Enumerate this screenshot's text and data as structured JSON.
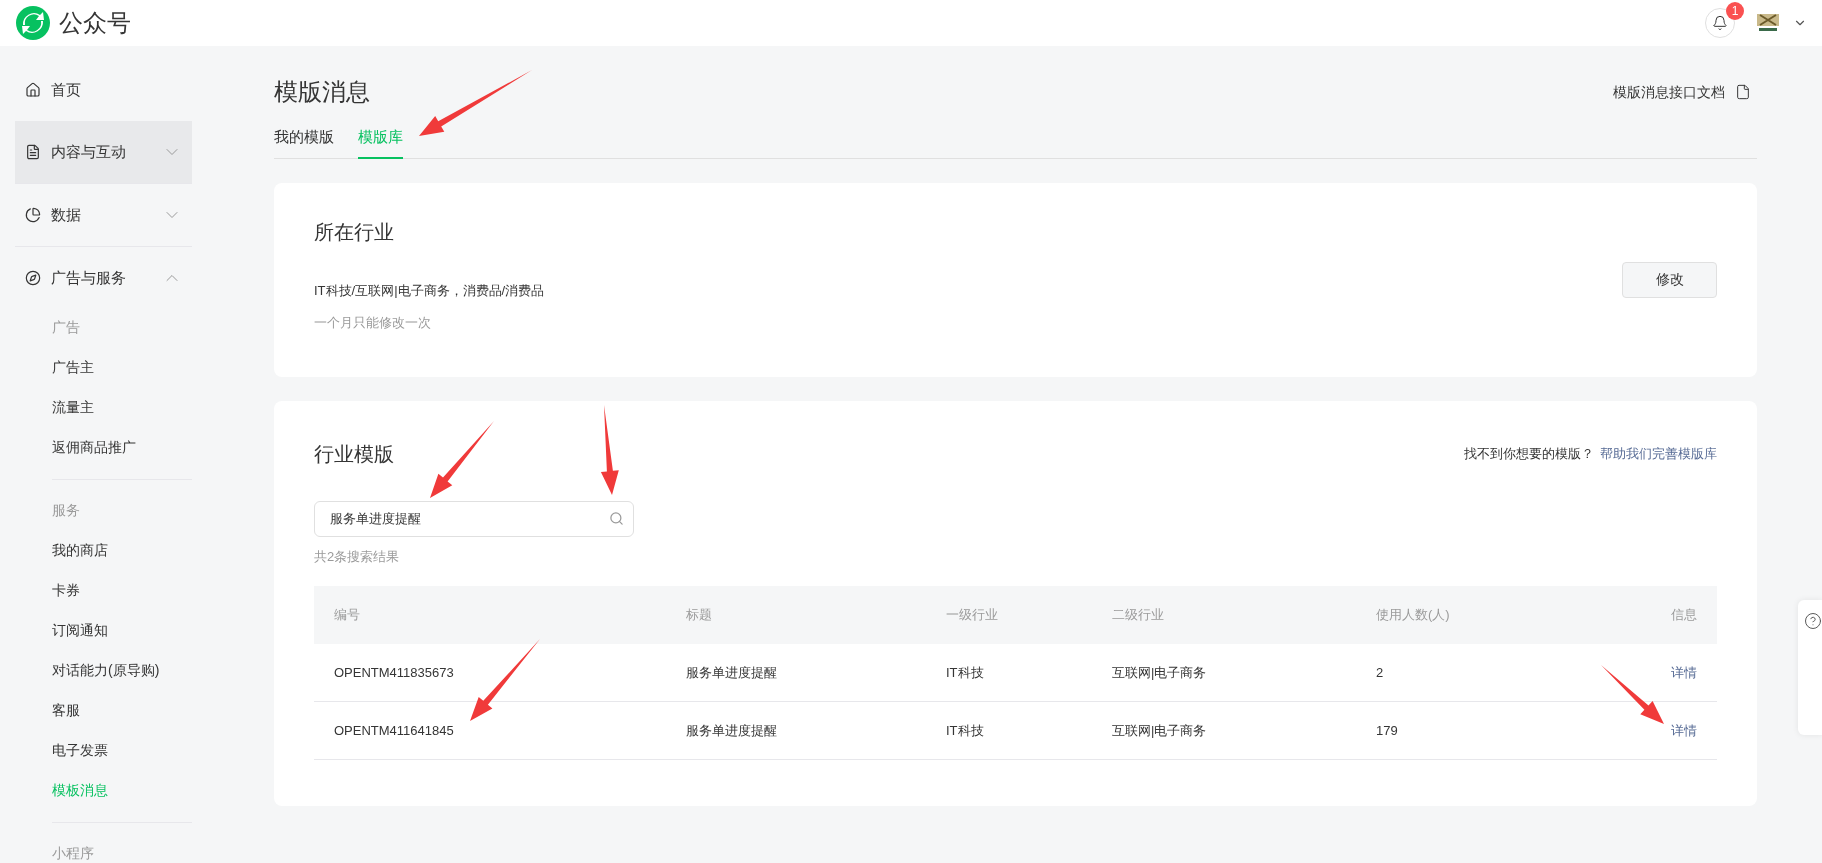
{
  "header": {
    "brand": "公众号",
    "notification_count": "1"
  },
  "sidebar": [
    {
      "kind": "link",
      "label": "首页",
      "highlighted": false
    },
    {
      "kind": "group",
      "label": "内容与互动",
      "expanded": false,
      "highlighted": true
    },
    {
      "kind": "group",
      "label": "数据",
      "expanded": false,
      "highlighted": false
    },
    {
      "kind": "group",
      "label": "广告与服务",
      "expanded": true,
      "highlighted": false,
      "sections": [
        {
          "heading": "广告",
          "items": [
            {
              "label": "广告主",
              "selected": false
            },
            {
              "label": "流量主",
              "selected": false
            },
            {
              "label": "返佣商品推广",
              "selected": false
            }
          ]
        },
        {
          "heading": "服务",
          "items": [
            {
              "label": "我的商店",
              "selected": false
            },
            {
              "label": "卡券",
              "selected": false
            },
            {
              "label": "订阅通知",
              "selected": false
            },
            {
              "label": "对话能力(原导购)",
              "selected": false
            },
            {
              "label": "客服",
              "selected": false
            },
            {
              "label": "电子发票",
              "selected": false
            },
            {
              "label": "模板消息",
              "selected": true
            }
          ]
        },
        {
          "heading": "小程序"
        }
      ]
    }
  ],
  "page": {
    "title": "模版消息",
    "doc_link": "模版消息接口文档",
    "tabs": [
      {
        "label": "我的模版",
        "selected": false
      },
      {
        "label": "模版库",
        "selected": true
      }
    ]
  },
  "industry_card": {
    "title": "所在行业",
    "industries": "IT科技/互联网|电子商务，消费品/消费品",
    "hint": "一个月只能修改一次",
    "button": "修改"
  },
  "templates_card": {
    "title": "行业模版",
    "question": "找不到你想要的模版？",
    "help_link": "帮助我们完善模版库",
    "search": {
      "value": "服务单进度提醒"
    },
    "result_count": "共2条搜索结果",
    "table": {
      "columns": [
        "编号",
        "标题",
        "一级行业",
        "二级行业",
        "使用人数(人)",
        "信息"
      ],
      "rows": [
        {
          "cells": [
            "OPENTM411835673",
            "服务单进度提醒",
            "IT科技",
            "互联网|电子商务",
            "2"
          ],
          "action": "详情"
        },
        {
          "cells": [
            "OPENTM411641845",
            "服务单进度提醒",
            "IT科技",
            "互联网|电子商务",
            "179"
          ],
          "action": "详情"
        }
      ]
    }
  }
}
